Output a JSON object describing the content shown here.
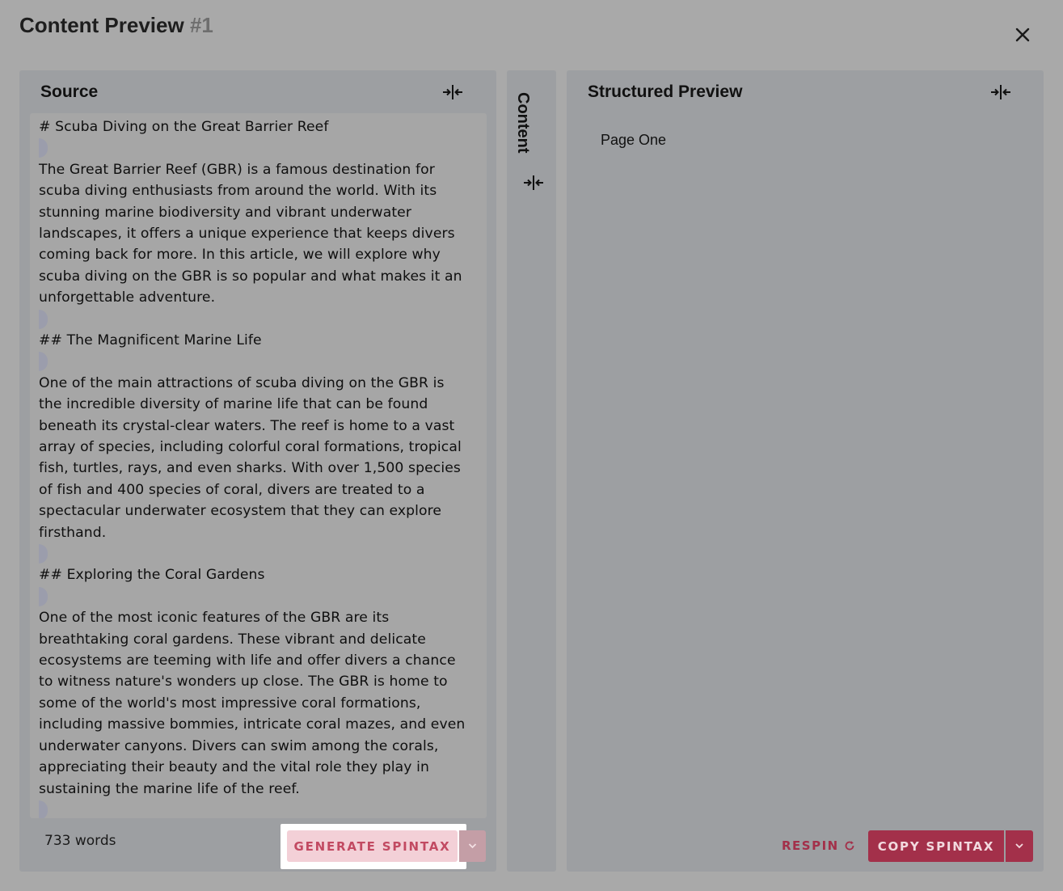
{
  "dialog": {
    "title": "Content Preview",
    "number": "#1"
  },
  "source": {
    "heading": "Source",
    "word_count": "733 words",
    "generate_label": "GENERATE SPINTAX",
    "lines": [
      "# Scuba Diving on the Great Barrier Reef",
      "",
      "The Great Barrier Reef (GBR) is a famous destination for",
      "scuba diving enthusiasts from around the world. With its",
      "stunning marine biodiversity and vibrant underwater",
      "landscapes, it offers a unique experience that keeps divers",
      "coming back for more. In this article, we will explore why",
      "scuba diving on the GBR is so popular and what makes it an",
      "unforgettable adventure.",
      "",
      "## The Magnificent Marine Life",
      "",
      "One of the main attractions of scuba diving on the GBR is",
      "the incredible diversity of marine life that can be found",
      "beneath its crystal-clear waters. The reef is home to a vast",
      "array of species, including colorful coral formations, tropical",
      "fish, turtles, rays, and even sharks. With over 1,500 species",
      "of fish and 400 species of coral, divers are treated to a",
      "spectacular underwater ecosystem that they can explore",
      "firsthand.",
      "",
      "## Exploring the Coral Gardens",
      "",
      "One of the most iconic features of the GBR are its",
      "breathtaking coral gardens. These vibrant and delicate",
      "ecosystems are teeming with life and offer divers a chance",
      "to witness nature's wonders up close. The GBR is home to",
      "some of the world's most impressive coral formations,",
      "including massive bommies, intricate coral mazes, and even",
      "underwater canyons. Divers can swim among the corals,",
      "appreciating their beauty and the vital role they play in",
      "sustaining the marine life of the reef.",
      ""
    ]
  },
  "content": {
    "label": "Content"
  },
  "preview": {
    "heading": "Structured Preview",
    "items": [
      "Page One"
    ],
    "respin_label": "RESPIN",
    "copy_label": "COPY SPINTAX"
  },
  "icons": {
    "close": "close-icon",
    "collapse": "collapse-horizontal-icon",
    "refresh": "refresh-icon",
    "chevron": "chevron-down-icon"
  },
  "colors": {
    "accent": "#a3304a",
    "accent_light": "#f3d0d7"
  }
}
